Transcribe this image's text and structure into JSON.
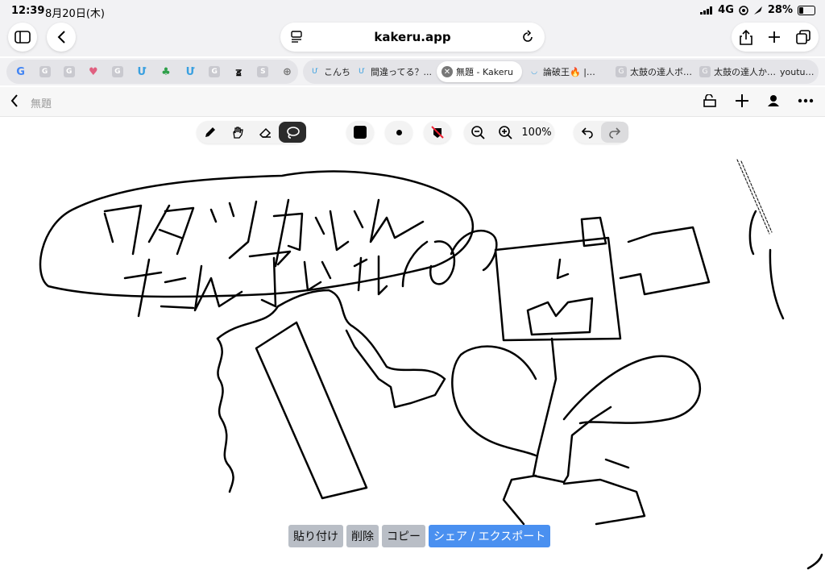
{
  "status": {
    "time": "12:39",
    "date": "8月20日(木)",
    "network": "4G",
    "battery": "28%"
  },
  "browser": {
    "url": "kakeru.app",
    "tabs": [
      {
        "label": "こんち",
        "icon": "kakeru-favicon"
      },
      {
        "label": "間違ってる？...",
        "icon": "kakeru-favicon"
      },
      {
        "label": "無題 - Kakeru",
        "icon": "close-icon",
        "active": true
      },
      {
        "label": "論破王🔥 |…",
        "icon": "smile-favicon"
      },
      {
        "label": "太鼓の達人ボ…",
        "icon": "g-favicon"
      },
      {
        "label": "太鼓の達人か…",
        "icon": "g-favicon"
      },
      {
        "label": "youtu…",
        "icon": "youtube-favicon"
      }
    ]
  },
  "app": {
    "title": "無題"
  },
  "toolbar": {
    "zoom": "100%",
    "color": "#000000"
  },
  "actions": {
    "paste": "貼り付け",
    "delete": "削除",
    "copy": "コピー",
    "share": "シェア / エクスポート"
  }
}
